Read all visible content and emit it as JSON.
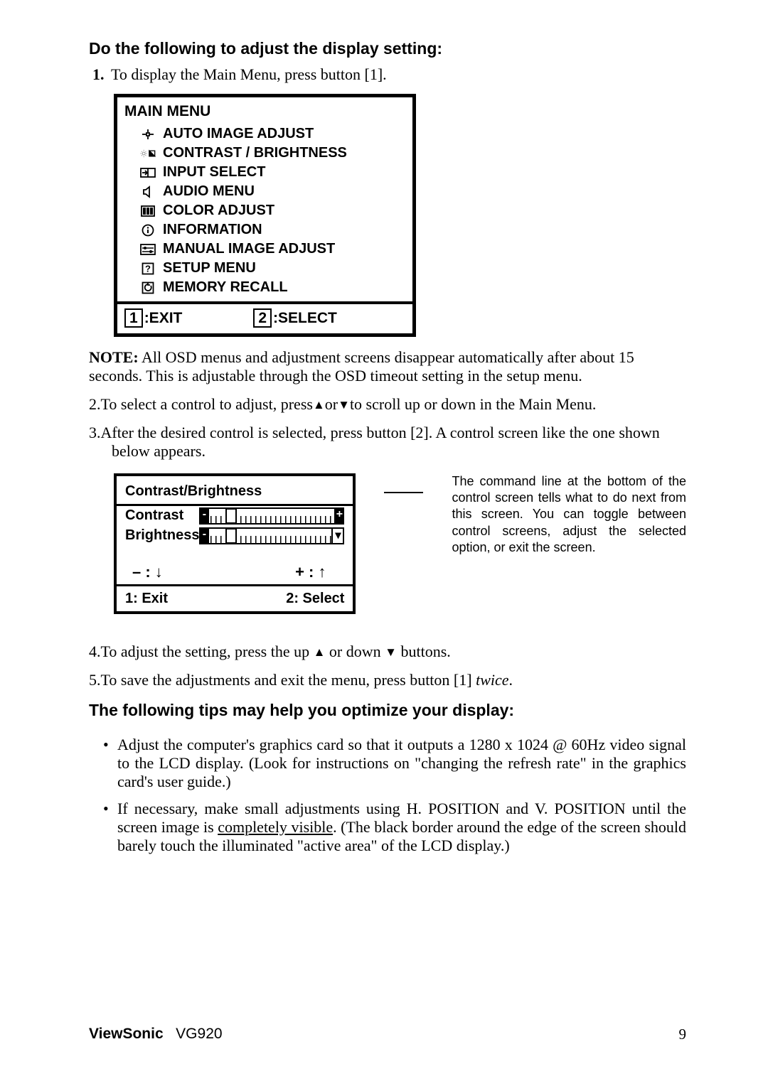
{
  "title1": "Do the following to adjust the display setting:",
  "step1_num": "1.",
  "step1_text": "To display the Main Menu, press button [1].",
  "menu": {
    "title": "MAIN MENU",
    "items": [
      "AUTO IMAGE ADJUST",
      "CONTRAST / BRIGHTNESS",
      "INPUT SELECT",
      "AUDIO MENU",
      "COLOR ADJUST",
      "INFORMATION",
      "MANUAL IMAGE ADJUST",
      "SETUP MENU",
      "MEMORY RECALL"
    ],
    "footer_exit_key": "1",
    "footer_exit": ":EXIT",
    "footer_select_key": "2",
    "footer_select": ":SELECT"
  },
  "note_label": "NOTE:",
  "note_text": " All OSD menus and adjustment screens disappear automatically after about 15 seconds. This is adjustable through the OSD timeout setting in the setup menu.",
  "step2_num": "2.",
  "step2_a": "To select a control to adjust, press",
  "step2_b": "or",
  "step2_c": "to scroll up or down in the Main Menu.",
  "step3_num": "3.",
  "step3_text": "After the desired control is selected, press button [2]. A control screen like the one shown below appears.",
  "cb": {
    "title": "Contrast/Brightness",
    "row1": "Contrast",
    "row2": "Brightness",
    "minus": "-",
    "plus_sym": "+",
    "arrow_left": "– : ↓",
    "arrow_right": "+ : ↑",
    "footer_left": "1: Exit",
    "footer_right": "2: Select"
  },
  "caption": "The command line at the bottom of the control screen tells what to do next from this screen. You can toggle between control screens, adjust the selected option, or exit the screen.",
  "step4_num": "4.",
  "step4_a": "To adjust the setting, press the up ",
  "step4_b": " or down ",
  "step4_c": " buttons.",
  "step5_num": "5.",
  "step5_a": "To save the adjustments and exit the menu, press button [1] ",
  "step5_twice": "twice",
  "step5_b": ".",
  "title2": "The following tips may help you optimize your display:",
  "tip1": "Adjust the computer's graphics card so that it outputs a 1280 x 1024 @ 60Hz video signal to the LCD display. (Look for instructions on \"changing the refresh rate\" in the graphics card's user guide.)",
  "tip2_a": "If necessary, make small adjustments using H. POSITION and V. POSITION until the screen image is ",
  "tip2_underline": "completely visible",
  "tip2_b": ". (The black border around the edge of the screen should barely touch the illuminated \"active area\" of the LCD display.)",
  "footer_brand": "ViewSonic",
  "footer_model": "VG920",
  "footer_page": "9"
}
